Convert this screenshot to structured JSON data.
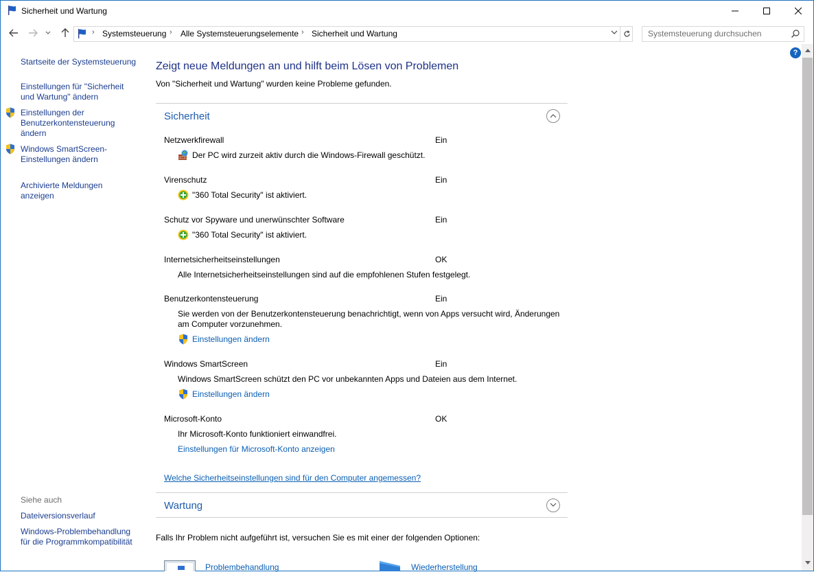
{
  "window": {
    "title": "Sicherheit und Wartung",
    "minimize": "–",
    "maximize": "☐",
    "close": "✕"
  },
  "nav": {
    "breadcrumbs": [
      "Systemsteuerung",
      "Alle Systemsteuerungselemente",
      "Sicherheit und Wartung"
    ],
    "separator": "›",
    "search_placeholder": "Systemsteuerung durchsuchen"
  },
  "sidebar": {
    "home": "Startseite der Systemsteuerung",
    "items": [
      {
        "label": "Einstellungen für \"Sicherheit und Wartung\" ändern",
        "shield": false
      },
      {
        "label": "Einstellungen der Benutzerkontensteuerung ändern",
        "shield": true
      },
      {
        "label": "Windows SmartScreen-Einstellungen ändern",
        "shield": true
      },
      {
        "label": "Archivierte Meldungen anzeigen",
        "shield": false
      }
    ],
    "see_also_title": "Siehe auch",
    "see_also": [
      "Dateiversionsverlauf",
      "Windows-Problembehandlung für die Programmkompatibilität"
    ]
  },
  "main": {
    "heading": "Zeigt neue Meldungen an und hilft beim Lösen von Problemen",
    "subheading": "Von \"Sicherheit und Wartung\" wurden keine Probleme gefunden.",
    "security": {
      "title": "Sicherheit",
      "items": [
        {
          "label": "Netzwerkfirewall",
          "status": "Ein",
          "desc": "Der PC wird zurzeit aktiv durch die Windows-Firewall geschützt."
        },
        {
          "label": "Virenschutz",
          "status": "Ein",
          "desc": "\"360 Total Security\" ist aktiviert."
        },
        {
          "label": "Schutz vor Spyware und unerwünschter Software",
          "status": "Ein",
          "desc": "\"360 Total Security\" ist aktiviert."
        },
        {
          "label": "Internetsicherheitseinstellungen",
          "status": "OK",
          "desc": "Alle Internetsicherheitseinstellungen sind auf die empfohlenen Stufen festgelegt."
        },
        {
          "label": "Benutzerkontensteuerung",
          "status": "Ein",
          "desc": "Sie werden von der Benutzerkontensteuerung benachrichtigt, wenn von Apps versucht wird, Änderungen am Computer vorzunehmen.",
          "link": "Einstellungen ändern"
        },
        {
          "label": "Windows SmartScreen",
          "status": "Ein",
          "desc": "Windows SmartScreen schützt den PC vor unbekannten Apps und Dateien aus dem Internet.",
          "link": "Einstellungen ändern"
        },
        {
          "label": "Microsoft-Konto",
          "status": "OK",
          "desc": "Ihr Microsoft-Konto funktioniert einwandfrei.",
          "link": "Einstellungen für Microsoft-Konto anzeigen"
        }
      ],
      "question_link": "Welche Sicherheitseinstellungen sind für den Computer angemessen?"
    },
    "maintenance": {
      "title": "Wartung"
    },
    "footer_text": "Falls Ihr Problem nicht aufgeführt ist, versuchen Sie es mit einer der folgenden Optionen:",
    "options": [
      "Problembehandlung",
      "Wiederherstellung"
    ]
  },
  "colors": {
    "accent": "#1e5cad",
    "link": "#0a5fb4",
    "border": "#1e74c0"
  }
}
